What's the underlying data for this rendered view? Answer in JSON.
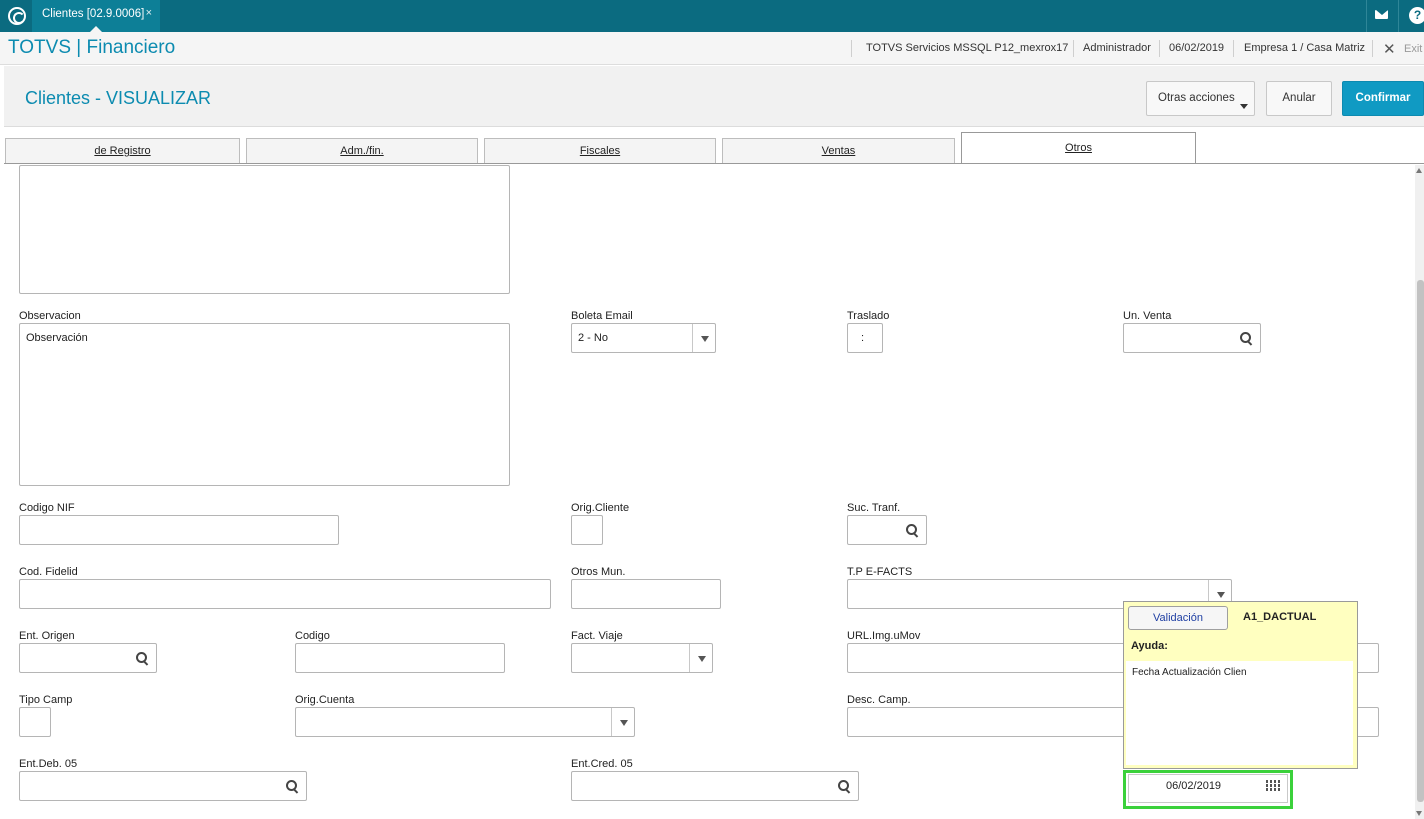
{
  "topbar": {
    "tab_label": "Clientes [02.9.0006]",
    "tab_close": "×"
  },
  "header": {
    "app_title": "TOTVS | Financiero",
    "environment": "TOTVS Servicios MSSQL P12_mexrox17",
    "user": "Administrador",
    "date": "06/02/2019",
    "company": "Empresa 1 / Casa Matriz",
    "exit_label": "Exit"
  },
  "page": {
    "title": "Clientes - VISUALIZAR",
    "buttons": {
      "otras_acciones": "Otras acciones",
      "anular": "Anular",
      "confirmar": "Confirmar"
    }
  },
  "tabs": [
    "de Registro",
    "Adm./fin.",
    "Fiscales",
    "Ventas",
    "Otros"
  ],
  "active_tab": "Otros",
  "form": {
    "observacion": {
      "label": "Observacion",
      "value": "Observación"
    },
    "boleta_email": {
      "label": "Boleta Email",
      "value": "2 - No"
    },
    "traslado": {
      "label": "Traslado",
      "value": ":"
    },
    "un_venta": {
      "label": "Un. Venta",
      "value": ""
    },
    "codigo_nif": {
      "label": "Codigo NIF",
      "value": ""
    },
    "orig_cliente": {
      "label": "Orig.Cliente",
      "value": ""
    },
    "suc_tranf": {
      "label": "Suc. Tranf.",
      "value": ""
    },
    "cod_fidelid": {
      "label": "Cod. Fidelid",
      "value": ""
    },
    "otros_mun": {
      "label": "Otros Mun.",
      "value": ""
    },
    "tp_efacts": {
      "label": "T.P E-FACTS",
      "value": ""
    },
    "ent_origen": {
      "label": "Ent. Origen",
      "value": ""
    },
    "codigo": {
      "label": "Codigo",
      "value": ""
    },
    "fact_viaje": {
      "label": "Fact. Viaje",
      "value": ""
    },
    "url_img": {
      "label": "URL.Img.uMov",
      "value": ""
    },
    "tipo_camp": {
      "label": "Tipo Camp",
      "value": ""
    },
    "orig_cuenta": {
      "label": "Orig.Cuenta",
      "value": ""
    },
    "desc_camp": {
      "label": "Desc. Camp.",
      "value": ""
    },
    "ent_deb": {
      "label": "Ent.Deb. 05",
      "value": ""
    },
    "ent_cred": {
      "label": "Ent.Cred. 05",
      "value": ""
    },
    "fecha_actualizacion": {
      "value": "06/02/2019"
    }
  },
  "help_popup": {
    "validacion_button": "Validación",
    "field_name": "A1_DACTUAL",
    "ayuda_label": "Ayuda:",
    "text": "Fecha Actualización Clien"
  },
  "colors": {
    "topbar": "#0b6b80",
    "accent": "#0c8bb0",
    "confirm_button": "#109ac3",
    "help_bg": "#ffffc0",
    "focus_border": "#3bd13b"
  }
}
